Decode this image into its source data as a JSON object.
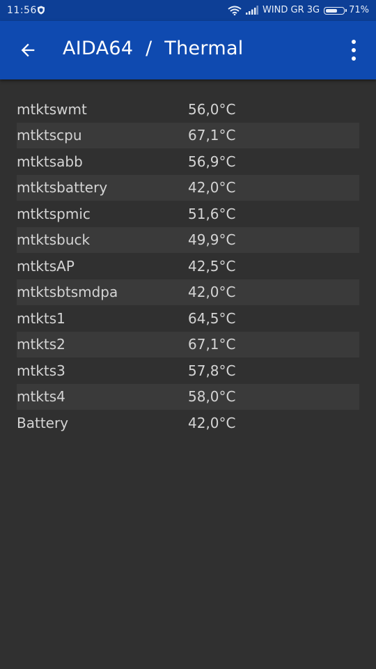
{
  "status_bar": {
    "time": "11:56",
    "carrier": "WIND GR 3G",
    "battery_percent": "71%",
    "battery_level": 0.71
  },
  "app_bar": {
    "title": "AIDA64  /  Thermal"
  },
  "sensors": [
    {
      "name": "mtktswmt",
      "value": "56,0°C"
    },
    {
      "name": "mtktscpu",
      "value": "67,1°C"
    },
    {
      "name": "mtktsabb",
      "value": "56,9°C"
    },
    {
      "name": "mtktsbattery",
      "value": "42,0°C"
    },
    {
      "name": "mtktspmic",
      "value": "51,6°C"
    },
    {
      "name": "mtktsbuck",
      "value": "49,9°C"
    },
    {
      "name": "mtktsAP",
      "value": "42,5°C"
    },
    {
      "name": "mtktsbtsmdpa",
      "value": "42,0°C"
    },
    {
      "name": "mtkts1",
      "value": "64,5°C"
    },
    {
      "name": "mtkts2",
      "value": "67,1°C"
    },
    {
      "name": "mtkts3",
      "value": "57,8°C"
    },
    {
      "name": "mtkts4",
      "value": "58,0°C"
    },
    {
      "name": "Battery",
      "value": "42,0°C"
    }
  ],
  "colors": {
    "status_bar_bg": "#0d3f96",
    "app_bar_bg": "#0f4ab0",
    "background": "#303030",
    "alt_row_bg": "#3a3a3a",
    "text": "#d4d4d4"
  },
  "icons": {
    "status_notification": "shield-icon",
    "wifi": "wifi-icon",
    "signal": "signal-icon",
    "battery": "battery-icon",
    "back": "arrow-back-icon",
    "menu": "more-vert-icon"
  }
}
